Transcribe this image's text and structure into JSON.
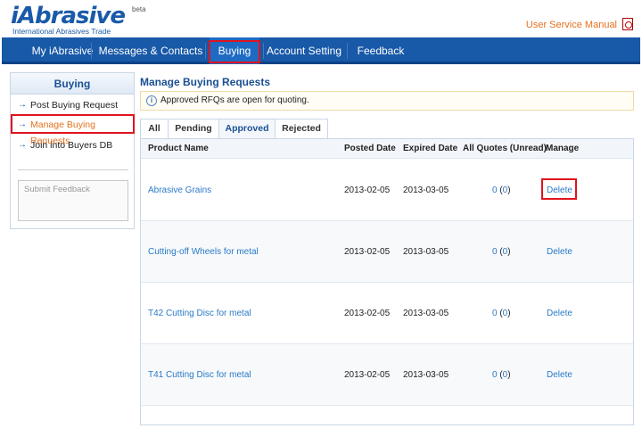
{
  "header": {
    "logo": "iAbrasive",
    "logo_tagline": "International Abrasives Trade",
    "beta": "beta",
    "manual_link": "User Service Manual"
  },
  "nav": {
    "items": [
      "My iAbrasive",
      "Messages & Contacts",
      "Buying",
      "Account Setting",
      "Feedback"
    ],
    "active": "Buying"
  },
  "sidebar": {
    "title": "Buying",
    "items": [
      "Post Buying Request",
      "Manage Buying Requests",
      "Join into Buyers DB"
    ],
    "active": "Manage Buying Requests",
    "feedback_placeholder": "Submit Feedback"
  },
  "main": {
    "title": "Manage Buying Requests",
    "notice": "Approved RFQs are open for quoting.",
    "tabs": [
      "All",
      "Pending",
      "Approved",
      "Rejected"
    ],
    "active_tab": "Approved",
    "columns": [
      "Product Name",
      "Posted Date",
      "Expired Date",
      "All Quotes (Unread)",
      "Manage"
    ],
    "rows": [
      {
        "product": "Abrasive Grains",
        "posted": "2013-02-05",
        "expired": "2013-03-05",
        "quotes": "0",
        "unread": "0",
        "action": "Delete"
      },
      {
        "product": "Cutting-off Wheels for metal",
        "posted": "2013-02-05",
        "expired": "2013-03-05",
        "quotes": "0",
        "unread": "0",
        "action": "Delete"
      },
      {
        "product": "T42 Cutting Disc for metal",
        "posted": "2013-02-05",
        "expired": "2013-03-05",
        "quotes": "0",
        "unread": "0",
        "action": "Delete"
      },
      {
        "product": "T41 Cutting Disc for metal",
        "posted": "2013-02-05",
        "expired": "2013-03-05",
        "quotes": "0",
        "unread": "0",
        "action": "Delete"
      }
    ]
  },
  "colors": {
    "brand": "#1a5aa8",
    "nav_bg": "#1859a8",
    "link": "#2a7ac7",
    "accent": "#e4701c",
    "highlight": "#e0141e"
  }
}
